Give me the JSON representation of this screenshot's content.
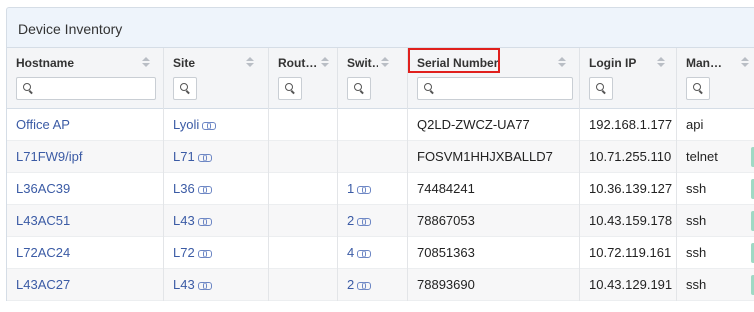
{
  "panel": {
    "title": "Device Inventory"
  },
  "columns": [
    {
      "key": "hostname",
      "label": "Hostname"
    },
    {
      "key": "site",
      "label": "Site"
    },
    {
      "key": "routes",
      "label": "Rout…"
    },
    {
      "key": "switchports",
      "label": "Swit…"
    },
    {
      "key": "serial",
      "label": "Serial Number"
    },
    {
      "key": "login_ip",
      "label": "Login IP"
    },
    {
      "key": "management",
      "label": "Man…"
    }
  ],
  "rows": [
    {
      "hostname": "Office AP",
      "site": "Lyoli",
      "routes": "",
      "switchports": "",
      "serial": "Q2LD-ZWCZ-UA77",
      "login_ip": "192.168.1.177",
      "management": "api",
      "status": false
    },
    {
      "hostname": "L71FW9/ipf",
      "site": "L71",
      "routes": "",
      "switchports": "",
      "serial": "FOSVM1HHJXBALLD7",
      "login_ip": "10.71.255.110",
      "management": "telnet",
      "status": true
    },
    {
      "hostname": "L36AC39",
      "site": "L36",
      "routes": "",
      "switchports": "1",
      "serial": "74484241",
      "login_ip": "10.36.139.127",
      "management": "ssh",
      "status": true
    },
    {
      "hostname": "L43AC51",
      "site": "L43",
      "routes": "",
      "switchports": "2",
      "serial": "78867053",
      "login_ip": "10.43.159.178",
      "management": "ssh",
      "status": true
    },
    {
      "hostname": "L72AC24",
      "site": "L72",
      "routes": "",
      "switchports": "4",
      "serial": "70851363",
      "login_ip": "10.72.119.161",
      "management": "ssh",
      "status": true
    },
    {
      "hostname": "L43AC27",
      "site": "L43",
      "routes": "",
      "switchports": "2",
      "serial": "78893690",
      "login_ip": "10.43.129.191",
      "management": "ssh",
      "status": true
    }
  ],
  "colors": {
    "link": "#3b5ba5",
    "highlight": "#e0201d",
    "status_chip": "#9fd9c4"
  },
  "icons": {
    "filter": "search-icon",
    "sort": "sort-icon",
    "site_link": "link-icon"
  }
}
